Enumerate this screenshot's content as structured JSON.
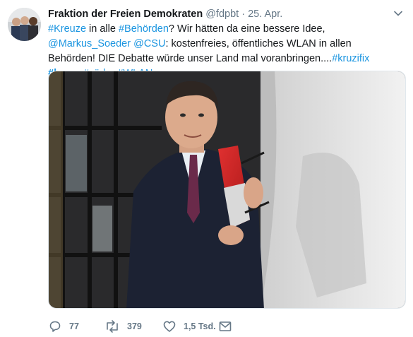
{
  "tweet": {
    "author_name": "Fraktion der Freien Demokraten",
    "handle": "@fdpbt",
    "separator": "·",
    "date": "25. Apr.",
    "text_parts": [
      {
        "t": "#Kreuze",
        "link": true
      },
      {
        "t": " in alle ",
        "link": false
      },
      {
        "t": "#Behörden",
        "link": true
      },
      {
        "t": "? Wir hätten da eine bessere Idee, ",
        "link": false
      },
      {
        "t": "@Markus_Soeder",
        "link": true
      },
      {
        "t": " ",
        "link": false
      },
      {
        "t": "@CSU",
        "link": true
      },
      {
        "t": ": kostenfreies, öffentliches WLAN in allen Behörden! DIE Debatte würde unser Land mal voranbringen....",
        "link": false
      },
      {
        "t": "#kruzifix",
        "link": true
      },
      {
        "t": " ",
        "link": false
      },
      {
        "t": "#kreuz",
        "link": true,
        "bold": true
      },
      {
        "t": " ",
        "link": false
      },
      {
        "t": "#söder",
        "link": true
      },
      {
        "t": " ",
        "link": false
      },
      {
        "t": "#WLAN",
        "link": true
      }
    ]
  },
  "actions": {
    "reply_count": "77",
    "retweet_count": "379",
    "like_count": "1,5 Tsd."
  },
  "icons": {
    "caret": "chevron-down-icon",
    "reply": "reply-icon",
    "retweet": "retweet-icon",
    "like": "heart-icon",
    "dm": "envelope-icon"
  },
  "colors": {
    "link": "#1b95e0",
    "muted": "#657786",
    "text": "#14171a"
  }
}
